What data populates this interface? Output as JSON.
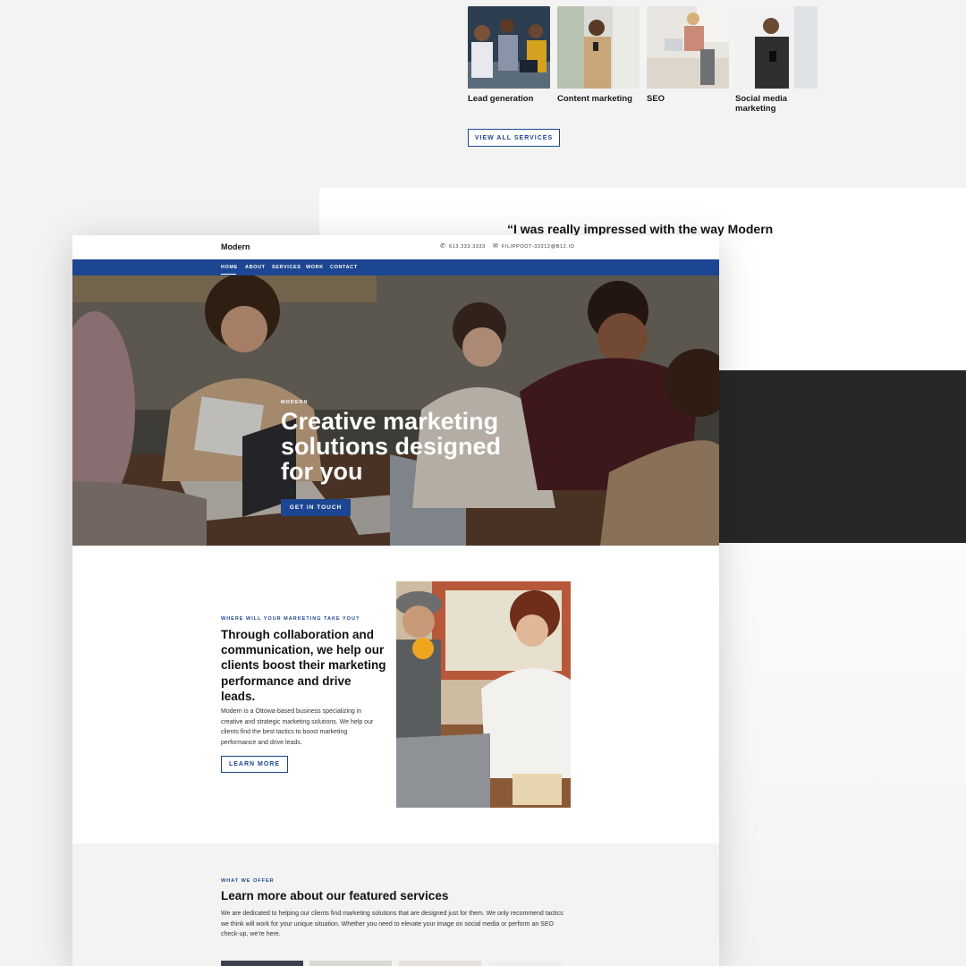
{
  "background_page": {
    "services": [
      {
        "label": "Lead generation"
      },
      {
        "label": "Content marketing"
      },
      {
        "label": "SEO"
      },
      {
        "label": "Social media marketing"
      }
    ],
    "view_all_label": "VIEW ALL SERVICES",
    "testimonial_excerpt": "“I was really impressed with the way Modern\n…versation to\n…helpful and"
  },
  "site": {
    "brand": "Modern",
    "phone": "613.333.3333",
    "email": "FILIPPOOT-33212@B12.IO",
    "nav": [
      "HOME",
      "ABOUT",
      "SERVICES",
      "WORK",
      "CONTACT"
    ]
  },
  "hero": {
    "eyebrow": "MODERN",
    "title": "Creative marketing solutions designed for you",
    "cta": "GET IN TOUCH"
  },
  "about": {
    "eyebrow": "WHERE WILL YOUR MARKETING TAKE YOU?",
    "title": "Through collaboration and communication, we help our clients boost their marketing performance and drive leads.",
    "body": "Modern is a Ottowa-based business specializing in creative and strategic marketing solutions. We help our clients find the best tactics to boost marketing performance and drive leads.",
    "cta": "LEARN MORE"
  },
  "offer": {
    "eyebrow": "WHAT WE OFFER",
    "title": "Learn more about our featured services",
    "body": "We are dedicated to helping our clients find marketing solutions that are designed just for them. We only recommend tactics we think will work for your unique situation. Whether you need to elevate your image on social media or perform an SEO check-up, we're here."
  },
  "colors": {
    "brand_blue": "#1d4692",
    "dark_band": "#272727",
    "page_bg": "#f3f3f4"
  }
}
